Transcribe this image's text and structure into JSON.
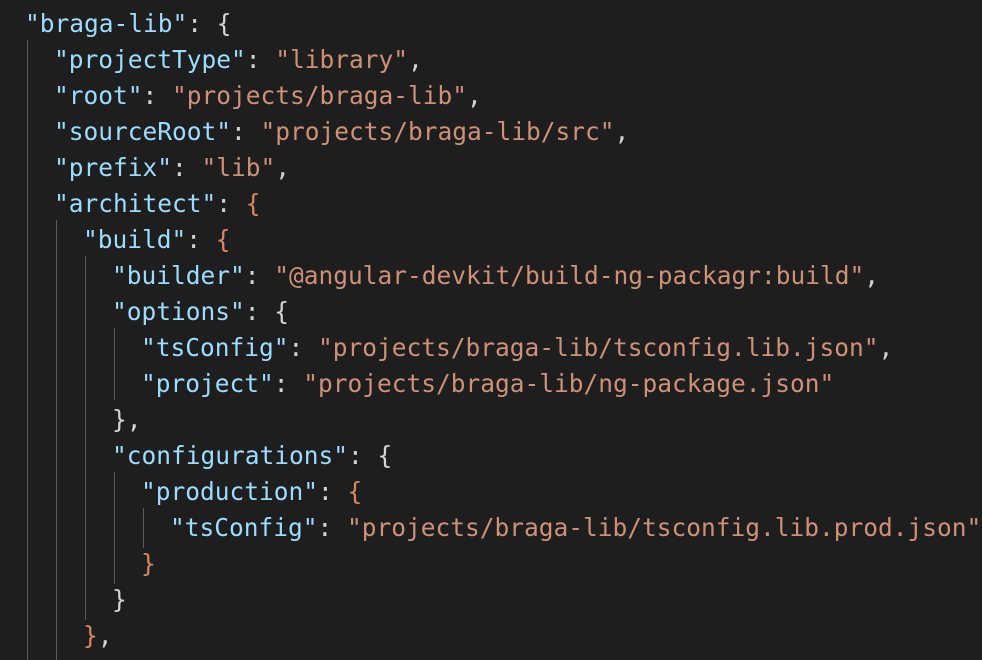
{
  "editor": {
    "lines": [
      {
        "key": "\"braga-lib\"",
        "sep": ": ",
        "open": "{"
      },
      {
        "key": "\"projectType\"",
        "sep": ": ",
        "value": "\"library\"",
        "end": ","
      },
      {
        "key": "\"root\"",
        "sep": ": ",
        "value": "\"projects/braga-lib\"",
        "end": ","
      },
      {
        "key": "\"sourceRoot\"",
        "sep": ": ",
        "value": "\"projects/braga-lib/src\"",
        "end": ","
      },
      {
        "key": "\"prefix\"",
        "sep": ": ",
        "value": "\"lib\"",
        "end": ","
      },
      {
        "key": "\"architect\"",
        "sep": ": ",
        "open": "{"
      },
      {
        "key": "\"build\"",
        "sep": ": ",
        "open": "{"
      },
      {
        "key": "\"builder\"",
        "sep": ": ",
        "value": "\"@angular-devkit/build-ng-packagr:build\"",
        "end": ","
      },
      {
        "key": "\"options\"",
        "sep": ": ",
        "open": "{"
      },
      {
        "key": "\"tsConfig\"",
        "sep": ": ",
        "value": "\"projects/braga-lib/tsconfig.lib.json\"",
        "end": ","
      },
      {
        "key": "\"project\"",
        "sep": ": ",
        "value": "\"projects/braga-lib/ng-package.json\""
      },
      {
        "close": "}",
        "end": ","
      },
      {
        "key": "\"configurations\"",
        "sep": ": ",
        "open": "{"
      },
      {
        "key": "\"production\"",
        "sep": ": ",
        "open": "{"
      },
      {
        "key": "\"tsConfig\"",
        "sep": ": ",
        "value": "\"projects/braga-lib/tsconfig.lib.prod.json\""
      },
      {
        "close": "}"
      },
      {
        "close": "}"
      },
      {
        "close": "}",
        "end": ","
      }
    ],
    "colors": {
      "background": "#1e1e1e",
      "key": "#9cdcfe",
      "string": "#ce9178",
      "punctuation": "#d4d4d4",
      "brace_level1": "#d4d4d4",
      "brace_level2": "#d7875f",
      "brace_level3": "#e6c07b"
    }
  }
}
